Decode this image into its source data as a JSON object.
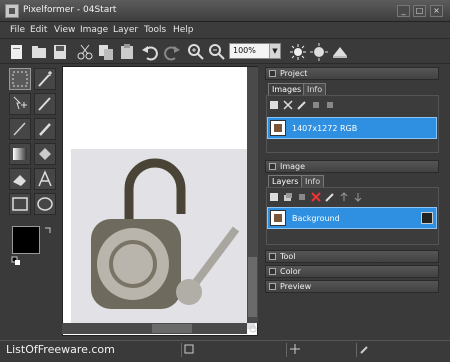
{
  "window": {
    "title": "Pixelformer - 04Start"
  },
  "menu": [
    "File",
    "Edit",
    "View",
    "Image",
    "Layer",
    "Tools",
    "Help"
  ],
  "toolbar": {
    "zoom_value": "100%"
  },
  "panels": {
    "project": {
      "header": "Project",
      "tabs": [
        "Images",
        "Info"
      ],
      "items": [
        {
          "label": "1407x1272 RGB"
        }
      ]
    },
    "image": {
      "header": "Image",
      "tabs": [
        "Layers",
        "Info"
      ],
      "layers": [
        {
          "label": "Background"
        }
      ]
    },
    "collapsed": [
      "Tool",
      "Color",
      "Preview"
    ]
  },
  "status": {
    "watermark": "ListOfFreeware.com"
  },
  "colors": {
    "accent": "#2f8fe0",
    "background": "#3a3a3a",
    "foreground_swatch": "#000000"
  }
}
